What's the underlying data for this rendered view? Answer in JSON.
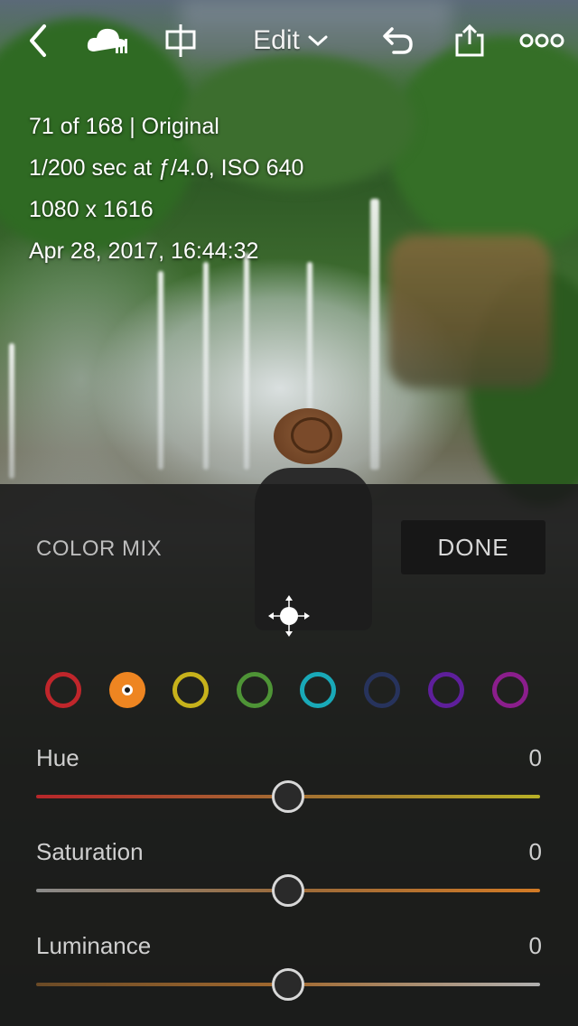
{
  "topbar": {
    "edit_label": "Edit"
  },
  "info": {
    "line1": "71 of 168 | Original",
    "line2": "1/200 sec at ƒ/4.0, ISO 640",
    "line3": "1080 x 1616",
    "line4": "Apr 28, 2017, 16:44:32"
  },
  "panel": {
    "title": "COLOR MIX",
    "done_label": "DONE",
    "swatches": [
      {
        "name": "red",
        "color": "#c0262b",
        "selected": false
      },
      {
        "name": "orange",
        "color": "#ee8521",
        "selected": true
      },
      {
        "name": "yellow",
        "color": "#c7b21b",
        "selected": false
      },
      {
        "name": "green",
        "color": "#4e9436",
        "selected": false
      },
      {
        "name": "aqua",
        "color": "#19a9b8",
        "selected": false
      },
      {
        "name": "blue",
        "color": "#27335c",
        "selected": false
      },
      {
        "name": "purple",
        "color": "#5e1f9b",
        "selected": false
      },
      {
        "name": "magenta",
        "color": "#8b1e8c",
        "selected": false
      }
    ],
    "sliders": [
      {
        "label": "Hue",
        "value": "0",
        "position": 0.5,
        "track_colors": [
          "#b8262a",
          "#a26c32",
          "#b8b026"
        ]
      },
      {
        "label": "Saturation",
        "value": "0",
        "position": 0.5,
        "track_colors": [
          "#8a8a8a",
          "#9a6a3a",
          "#d27a25"
        ]
      },
      {
        "label": "Luminance",
        "value": "0",
        "position": 0.5,
        "track_colors": [
          "#6a4a26",
          "#a2692f",
          "#b0b0b0"
        ]
      }
    ]
  }
}
